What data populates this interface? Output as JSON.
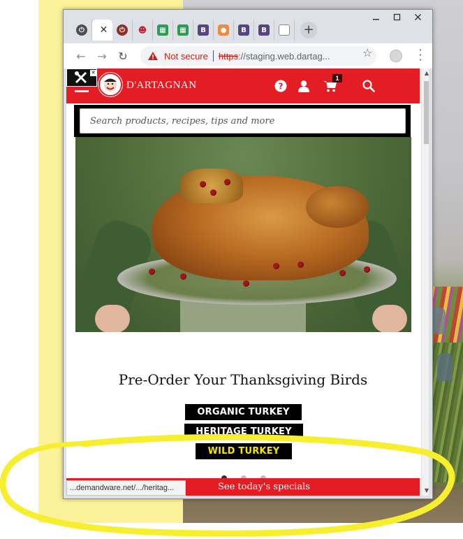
{
  "browser": {
    "window_controls": [
      "minimize",
      "maximize",
      "close"
    ],
    "tabs": [
      {
        "icon": "power-icon"
      },
      {
        "icon": "close-icon",
        "active": true
      },
      {
        "icon": "power-icon"
      },
      {
        "icon": "mascot-icon"
      },
      {
        "icon": "sheet-icon"
      },
      {
        "icon": "sheet-icon"
      },
      {
        "icon": "b-icon",
        "letter": "B"
      },
      {
        "icon": "chat-icon"
      },
      {
        "icon": "b-icon",
        "letter": "B"
      },
      {
        "icon": "b-icon",
        "letter": "B"
      },
      {
        "icon": "doc-icon"
      }
    ],
    "new_tab": "+",
    "omnibox": {
      "warning": "Not secure",
      "scheme": "https",
      "url_rest": "://staging.web.dartag..."
    }
  },
  "site": {
    "brand": "D'ARTAGNAN",
    "cart_count": "1",
    "search_placeholder": "Search products, recipes, tips and more",
    "promo_title": "Pre-Order Your Thanksgiving Birds",
    "buttons": {
      "organic": "ORGANIC TURKEY",
      "heritage": "HERITAGE TURKEY",
      "wild": "WILD TURKEY"
    },
    "specials": "See today's specials",
    "status_url": "...demandware.net/.../heritag..."
  },
  "colors": {
    "brand_red": "#e41d25",
    "wild_text": "#f3e600",
    "highlight_yellow": "#f6ef2f"
  }
}
